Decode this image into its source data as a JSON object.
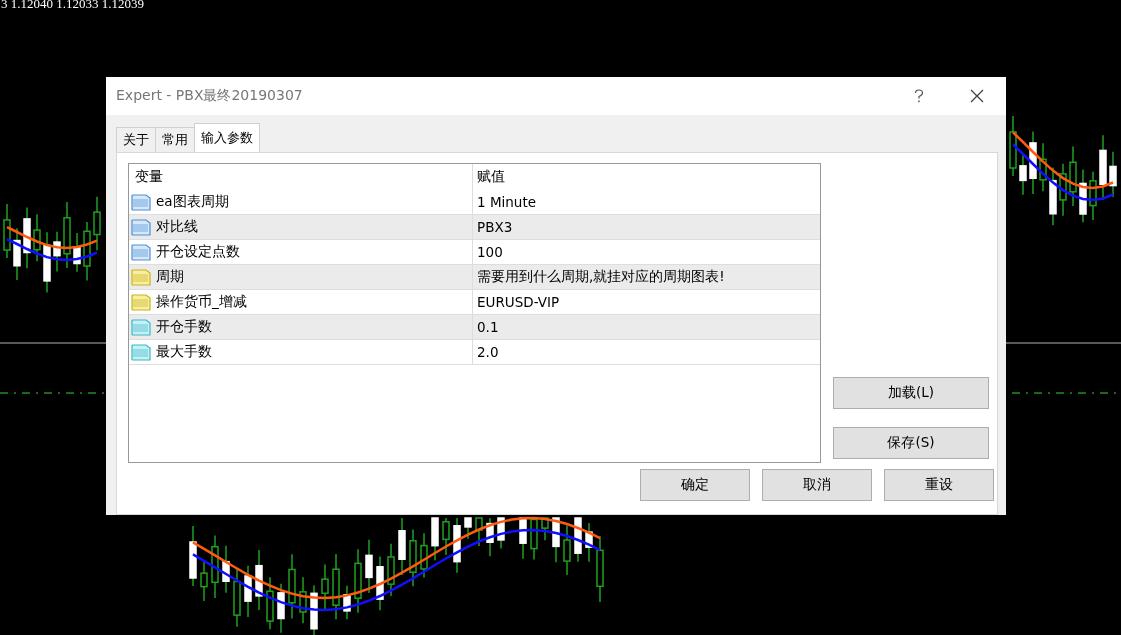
{
  "chart": {
    "quote": "3 1.12040 1.12033 1.12039"
  },
  "window": {
    "title": "Expert - PBX最终20190307"
  },
  "tabs": [
    {
      "label": "关于",
      "selected": false
    },
    {
      "label": "常用",
      "selected": false
    },
    {
      "label": "输入参数",
      "selected": true
    }
  ],
  "table": {
    "columns": [
      "变量",
      "赋值"
    ],
    "rows": [
      {
        "kind": "int",
        "name": "ea图表周期",
        "value": "1 Minute"
      },
      {
        "kind": "int",
        "name": "对比线",
        "value": "PBX3"
      },
      {
        "kind": "int",
        "name": "开仓设定点数",
        "value": "100"
      },
      {
        "kind": "string",
        "name": "周期",
        "value": "需要用到什么周期,就挂对应的周期图表!"
      },
      {
        "kind": "string",
        "name": "操作货币_增减",
        "value": "EURUSD-VIP"
      },
      {
        "kind": "double",
        "name": "开仓手数",
        "value": "0.1"
      },
      {
        "kind": "double",
        "name": "最大手数",
        "value": "2.0"
      }
    ]
  },
  "side_buttons": [
    "加载(L)",
    "保存(S)"
  ],
  "buttons": [
    "确定",
    "取消",
    "重设"
  ]
}
